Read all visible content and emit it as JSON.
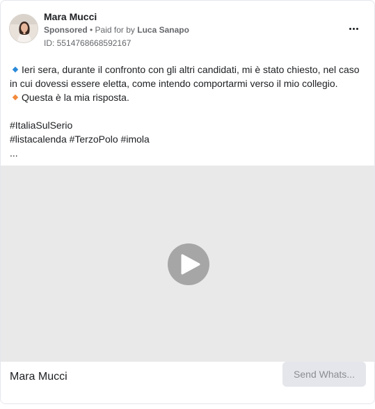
{
  "post": {
    "author_name": "Mara Mucci",
    "sponsored_label": "Sponsored",
    "separator": " • ",
    "paid_for_by_prefix": "Paid for by ",
    "paid_for_by_name": "Luca Sanapo",
    "ad_id": "ID: 5514768668592167",
    "more_icon": "more-horizontal-icon",
    "body": {
      "line1": "Ieri sera, durante il confronto con gli altri candidati, mi è stato chiesto, nel caso in cui dovessi essere eletta, come intendo comportarmi verso il mio collegio.",
      "line2": "Questa è la mia risposta.",
      "line3": "#ItaliaSulSerio",
      "line4": "#listacalenda #TerzoPolo #imola",
      "line5": "..."
    },
    "bullet_colors": {
      "blue": "#2a8ad8",
      "orange": "#f28a3c"
    }
  },
  "video": {
    "play_icon": "play-icon"
  },
  "footer": {
    "page_name": "Mara Mucci",
    "cta_label": "Send Whats..."
  }
}
